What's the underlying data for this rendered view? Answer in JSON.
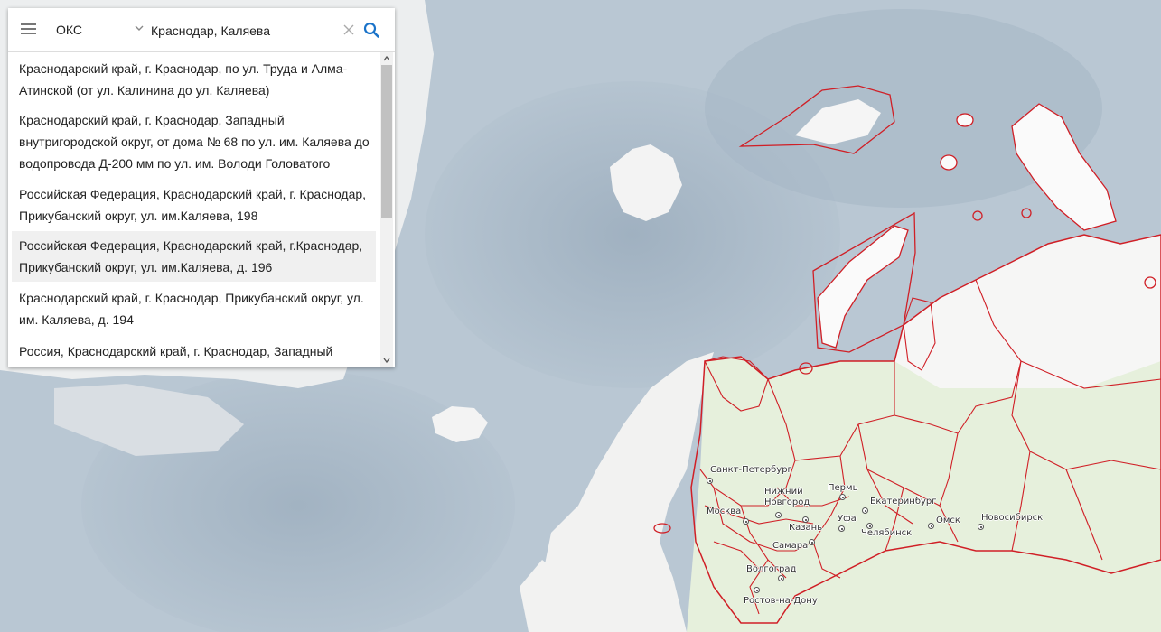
{
  "search": {
    "object_type": "ОКС",
    "query": "Краснодар, Каляева "
  },
  "results": [
    "Краснодарский край, г. Краснодар, по ул. Труда и Алма-Атинской (от ул. Калинина до ул. Каляева)",
    "Краснодарский край, г. Краснодар, Западный внутригородской округ, от дома № 68 по ул. им. Каляева до водопровода Д-200 мм по ул. им. Володи Головатого",
    "Российская Федерация, Краснодарский край, г. Краснодар, Прикубанский округ, ул. им.Каляева, 198",
    "Российская Федерация, Краснодарский край, г.Краснодар, Прикубанский округ, ул. им.Каляева, д. 196",
    "Краснодарский край, г. Краснодар, Прикубанский округ, ул. им. Каляева, д. 194",
    "Россия, Краснодарский край, г. Краснодар, Западный"
  ],
  "highlighted_result": 3,
  "cities": [
    "Санкт-Петербург",
    "Нижний Новгород",
    "Пермь",
    "Екатеринбург",
    "Москва",
    "Казань",
    "Уфа",
    "Челябинск",
    "Омск",
    "Новосибирск",
    "Самара",
    "Волгоград",
    "Ростов-на-Дону"
  ],
  "colors": {
    "ocean": "#b9c7d3",
    "land": "#f4f4f2",
    "russia_land": "#e6f0dc",
    "region_border": "#d01f26",
    "accent": "#1a73c9"
  },
  "icons": {
    "menu": "hamburger-icon",
    "dropdown": "chevron-down-icon",
    "clear": "close-icon",
    "search": "search-icon"
  }
}
